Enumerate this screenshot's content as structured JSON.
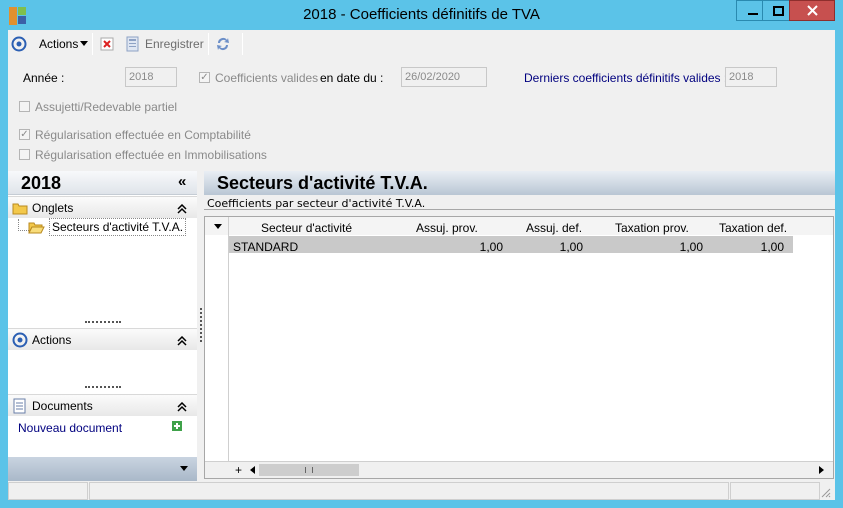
{
  "window": {
    "title": "2018 -  Coefficients définitifs de TVA"
  },
  "toolbar": {
    "actions_label": "Actions",
    "save_label": "Enregistrer"
  },
  "form": {
    "annee_label": "Année :",
    "annee_value": "2018",
    "coeff_valides_label": "Coefficients valides",
    "coeff_valides_checked": true,
    "en_date_du_label": "en date du :",
    "en_date_du_value": "26/02/2020",
    "derniers_label": "Derniers coefficients définitifs valides :",
    "derniers_value": "2018",
    "assujetti_label": "Assujetti/Redevable partiel",
    "assujetti_checked": false,
    "reg_compta_label": "Régularisation effectuée en Comptabilité",
    "reg_compta_checked": true,
    "reg_immo_label": "Régularisation effectuée en Immobilisations",
    "reg_immo_checked": false
  },
  "left_panel": {
    "year": "2018",
    "collapse_glyph": "«",
    "onglets_label": "Onglets",
    "onglets_item": "Secteurs d'activité T.V.A.",
    "actions_label": "Actions",
    "documents_label": "Documents",
    "new_document_label": "Nouveau document"
  },
  "main": {
    "title": "Secteurs d'activité T.V.A.",
    "subtitle": "Coefficients par secteur d'activité T.V.A.",
    "grid": {
      "columns": [
        "Secteur d'activité",
        "Assuj. prov.",
        "Assuj. def.",
        "Taxation prov.",
        "Taxation def."
      ],
      "rows": [
        [
          "STANDARD",
          "1,00",
          "1,00",
          "1,00",
          "1,00"
        ]
      ],
      "add_glyph": "+"
    }
  },
  "colors": {
    "window_frame": "#5bc3e8",
    "close_button": "#c7504f",
    "link_blue": "#00007f"
  }
}
